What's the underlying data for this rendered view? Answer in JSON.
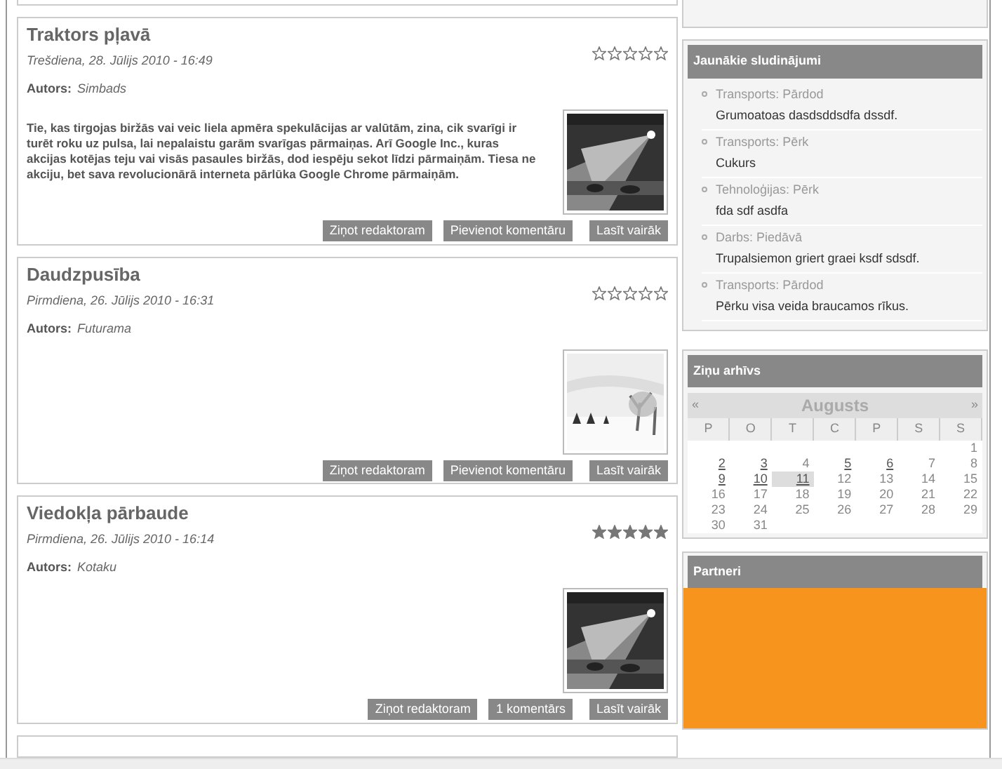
{
  "articles": [
    {
      "title": "Traktors pļavā",
      "date": "Trešdiena, 28. Jūlijs 2010 - 16:49",
      "author_label": "Autors:",
      "author": "Simbads",
      "stars": 0,
      "body": "Tie, kas tirgojas biržās vai veic liela apmēra spekulācijas ar valūtām, zina, cik svarīgi ir turēt roku uz pulsa, lai nepalaistu garām svarīgas pārmaiņas. Arī Google Inc., kuras akcijas kotējas teju vai visās pasaules biržās, dod iespēju sekot līdzi pārmaiņām. Tiesa ne akciju, bet sava revolucionārā interneta pārlūka Google Chrome pārmaiņām.",
      "buttons": [
        "Ziņot redaktoram",
        "Pievienot komentāru",
        "Lasīt vairāk"
      ]
    },
    {
      "title": "Daudzpusība",
      "date": "Pirmdiena, 26. Jūlijs 2010 - 16:31",
      "author_label": "Autors:",
      "author": "Futurama",
      "stars": 0,
      "buttons": [
        "Ziņot redaktoram",
        "Pievienot komentāru",
        "Lasīt vairāk"
      ]
    },
    {
      "title": "Viedokļa pārbaude",
      "date": "Pirmdiena, 26. Jūlijs 2010 - 16:14",
      "author_label": "Autors:",
      "author": "Kotaku",
      "stars": 5,
      "buttons": [
        "Ziņot redaktoram",
        "1 komentārs",
        "Lasīt vairāk"
      ]
    }
  ],
  "ads": {
    "title": "Jaunākie sludinājumi",
    "items": [
      {
        "category": "Transports: Pārdod",
        "text": "Grumoatoas dasdsddsdfa dssdf."
      },
      {
        "category": "Transports: Pērk",
        "text": "Cukurs"
      },
      {
        "category": "Tehnoloģijas: Pērk",
        "text": "fda sdf asdfa"
      },
      {
        "category": "Darbs: Piedāvā",
        "text": "Trupalsiemon griert graei ksdf sdsdf."
      },
      {
        "category": "Transports: Pārdod",
        "text": "Pērku visa veida braucamos rīkus."
      }
    ]
  },
  "archive": {
    "title": "Ziņu arhīvs",
    "prev": "«",
    "month": "Augusts",
    "next": "»",
    "weekdays": [
      "P",
      "O",
      "T",
      "C",
      "P",
      "S",
      "S"
    ],
    "weeks": [
      {
        "kind": "lead",
        "days": [
          {
            "day": "1",
            "link": false,
            "selected": false
          }
        ]
      },
      {
        "kind": "full",
        "days": [
          {
            "day": "2",
            "link": true,
            "selected": false
          },
          {
            "day": "3",
            "link": true,
            "selected": false
          },
          {
            "day": "4",
            "link": false,
            "selected": false
          },
          {
            "day": "5",
            "link": true,
            "selected": false
          },
          {
            "day": "6",
            "link": true,
            "selected": false
          },
          {
            "day": "7",
            "link": false,
            "selected": false
          },
          {
            "day": "8",
            "link": false,
            "selected": false
          }
        ]
      },
      {
        "kind": "full",
        "days": [
          {
            "day": "9",
            "link": true,
            "selected": false
          },
          {
            "day": "10",
            "link": true,
            "selected": false
          },
          {
            "day": "11",
            "link": true,
            "selected": true
          },
          {
            "day": "12",
            "link": false,
            "selected": false
          },
          {
            "day": "13",
            "link": false,
            "selected": false
          },
          {
            "day": "14",
            "link": false,
            "selected": false
          },
          {
            "day": "15",
            "link": false,
            "selected": false
          }
        ]
      },
      {
        "kind": "full",
        "days": [
          {
            "day": "16",
            "link": false,
            "selected": false
          },
          {
            "day": "17",
            "link": false,
            "selected": false
          },
          {
            "day": "18",
            "link": false,
            "selected": false
          },
          {
            "day": "19",
            "link": false,
            "selected": false
          },
          {
            "day": "20",
            "link": false,
            "selected": false
          },
          {
            "day": "21",
            "link": false,
            "selected": false
          },
          {
            "day": "22",
            "link": false,
            "selected": false
          }
        ]
      },
      {
        "kind": "full",
        "days": [
          {
            "day": "23",
            "link": false,
            "selected": false
          },
          {
            "day": "24",
            "link": false,
            "selected": false
          },
          {
            "day": "25",
            "link": false,
            "selected": false
          },
          {
            "day": "26",
            "link": false,
            "selected": false
          },
          {
            "day": "27",
            "link": false,
            "selected": false
          },
          {
            "day": "28",
            "link": false,
            "selected": false
          },
          {
            "day": "29",
            "link": false,
            "selected": false
          }
        ]
      },
      {
        "kind": "full",
        "days": [
          {
            "day": "30",
            "link": false,
            "selected": false
          },
          {
            "day": "31",
            "link": false,
            "selected": false
          }
        ]
      }
    ]
  },
  "partners": {
    "title": "Partneri"
  }
}
